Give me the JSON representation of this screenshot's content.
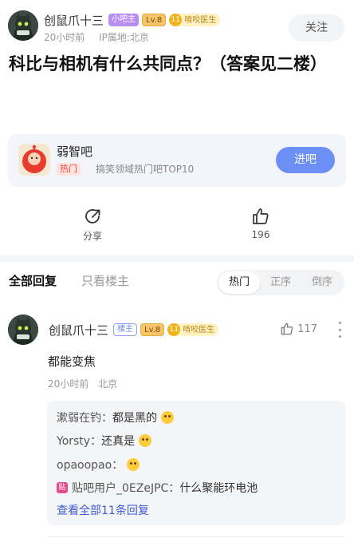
{
  "post": {
    "author": "创鼠爪十三",
    "badges": {
      "admin": "小吧主",
      "level": "Lv.8",
      "title": "啃咬医生",
      "medal": "11"
    },
    "time": "20小时前",
    "ip": "IP属地:北京",
    "follow_label": "关注",
    "title": "科比与相机有什么共同点？（答案见二楼）"
  },
  "forum": {
    "name": "弱智吧",
    "tag": "热门",
    "desc": "搞笑领域热门吧TOP10",
    "enter_label": "进吧"
  },
  "actions": {
    "share_label": "分享",
    "like_count": "196"
  },
  "replies_header": {
    "tab_all": "全部回复",
    "tab_owner": "只看楼主",
    "sort_options": [
      "热门",
      "正序",
      "倒序"
    ],
    "sort_active": "热门"
  },
  "reply": {
    "author": "创鼠爪十三",
    "owner_badge": "楼主",
    "level": "Lv.8",
    "title": "啃咬医生",
    "medal": "11",
    "like_count": "117",
    "text": "都能变焦",
    "time": "20小时前",
    "location": "北京",
    "sub_replies": [
      {
        "name": "漱弱在钓：",
        "text": "都是黑的",
        "emoji": "grinning-face-emoji"
      },
      {
        "name": "Yorsty：",
        "text": "还真是",
        "emoji": "astonished-face-emoji"
      },
      {
        "name": "opaoopao：",
        "text": "",
        "emoji": "astonished-face-emoji"
      },
      {
        "name": "贴吧用户_0EZeJPC：",
        "text": "什么聚能环电池",
        "emoji": ""
      }
    ],
    "user_icon": "贴",
    "view_all": "查看全部11条回复"
  },
  "colors": {
    "accent": "#6c8ff6",
    "link": "#3d5bd4",
    "hot_tag": "#f0473a",
    "admin_badge": "#b78ef2"
  }
}
